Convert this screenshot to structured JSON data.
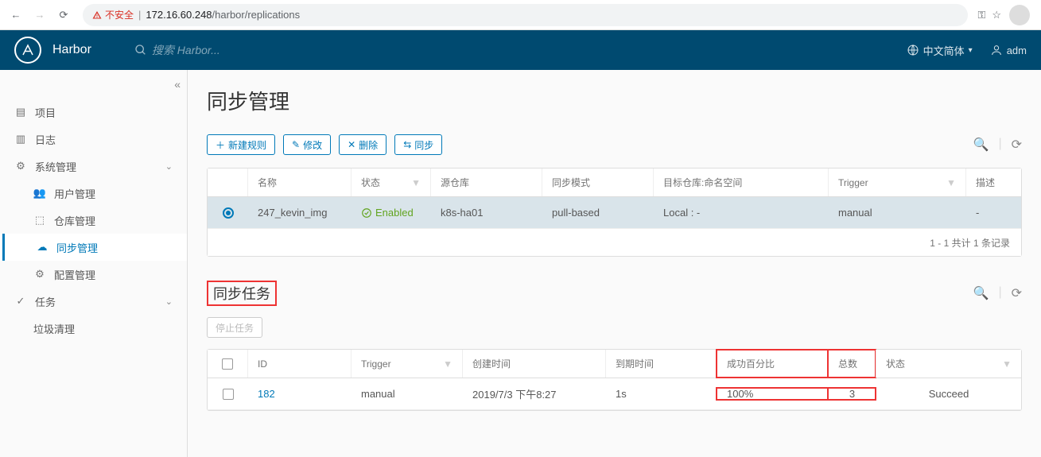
{
  "browser": {
    "insecure_label": "不安全",
    "url_host": "172.16.60.248",
    "url_path": "/harbor/replications"
  },
  "header": {
    "brand": "Harbor",
    "search_placeholder": "搜索 Harbor...",
    "lang_label": "中文简体",
    "user_label": "adm"
  },
  "sidebar": {
    "projects": "项目",
    "logs": "日志",
    "sysadmin": "系统管理",
    "user_mgmt": "用户管理",
    "registry": "仓库管理",
    "replication": "同步管理",
    "config": "配置管理",
    "tasks": "任务",
    "gc": "垃圾清理"
  },
  "page": {
    "title": "同步管理",
    "buttons": {
      "new_rule": "新建规则",
      "edit": "修改",
      "delete": "删除",
      "replicate": "同步"
    },
    "rules": {
      "headers": {
        "name": "名称",
        "status": "状态",
        "src_registry": "源仓库",
        "mode": "同步模式",
        "dest": "目标仓库:命名空间",
        "trigger": "Trigger",
        "desc": "描述"
      },
      "rows": [
        {
          "name": "247_kevin_img",
          "status": "Enabled",
          "src": "k8s-ha01",
          "mode": "pull-based",
          "dest": "Local : -",
          "trigger": "manual",
          "desc": "-"
        }
      ],
      "footer": "1 - 1 共计 1 条记录"
    },
    "jobs": {
      "title": "同步任务",
      "stop_btn": "停止任务",
      "headers": {
        "id": "ID",
        "trigger": "Trigger",
        "created": "创建时间",
        "duration": "到期时间",
        "success_rate": "成功百分比",
        "total": "总数",
        "status": "状态"
      },
      "rows": [
        {
          "id": "182",
          "trigger": "manual",
          "created": "2019/7/3 下午8:27",
          "duration": "1s",
          "success_rate": "100%",
          "total": "3",
          "status": "Succeed"
        }
      ]
    }
  }
}
